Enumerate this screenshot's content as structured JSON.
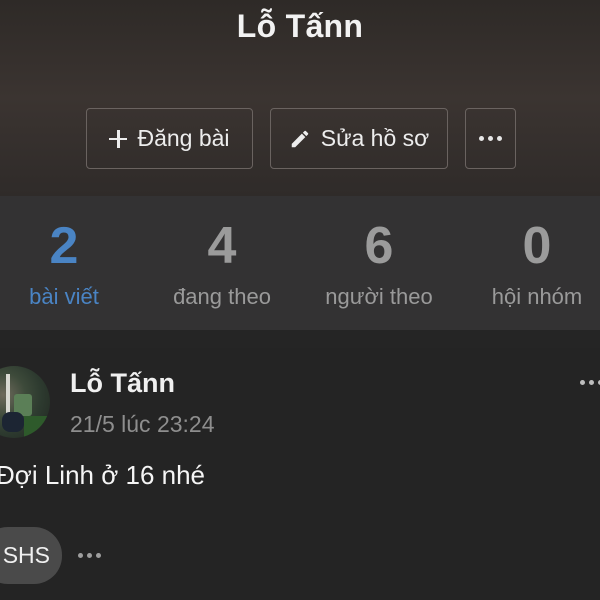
{
  "profile": {
    "name": "Lỗ Tấnn"
  },
  "actions": {
    "post_label": "Đăng bài",
    "edit_label": "Sửa hồ sơ",
    "more_icon": "more-horizontal-icon"
  },
  "stats": [
    {
      "value": "2",
      "label": "bài viết",
      "active": true
    },
    {
      "value": "4",
      "label": "đang theo",
      "active": false
    },
    {
      "value": "6",
      "label": "người theo",
      "active": false
    },
    {
      "value": "0",
      "label": "hội nhóm",
      "active": false
    }
  ],
  "post": {
    "author": "Lỗ Tấnn",
    "timestamp": "21/5 lúc 23:24",
    "text": "Đợi Linh ở 16 nhé",
    "tag": "SHS"
  },
  "colors": {
    "accent": "#4a84c4",
    "background": "#252525",
    "stats_bar": "#333233"
  }
}
